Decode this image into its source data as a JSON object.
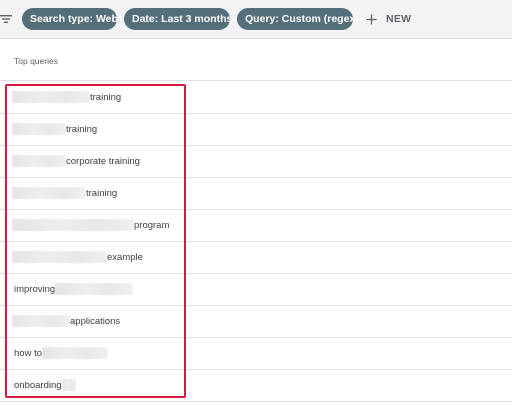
{
  "filters": {
    "chips": [
      {
        "label": "Search type: Web",
        "action_icon": "pencil-icon"
      },
      {
        "label": "Date: Last 3 months",
        "action_icon": "pencil-icon"
      },
      {
        "label": "Query: Custom (regex)",
        "action_icon": "close-circle-icon"
      }
    ],
    "new_label": "NEW"
  },
  "table": {
    "column_header": "Top queries",
    "rows": [
      {
        "text": "training",
        "redacted_position": "before"
      },
      {
        "text": "training",
        "redacted_position": "before"
      },
      {
        "text": "corporate training",
        "redacted_position": "before"
      },
      {
        "text": "training",
        "redacted_position": "before"
      },
      {
        "text": "program",
        "redacted_position": "before"
      },
      {
        "text": "example",
        "redacted_position": "before"
      },
      {
        "text": "improving",
        "redacted_position": "after"
      },
      {
        "text": "applications",
        "redacted_position": "before"
      },
      {
        "text": "how to",
        "redacted_position": "after"
      },
      {
        "text": "onboarding",
        "redacted_position": "after"
      }
    ]
  },
  "colors": {
    "chip_background": "#546e7a",
    "highlight_border": "#d81b3c",
    "filterbar_background": "#f1f3f4"
  }
}
